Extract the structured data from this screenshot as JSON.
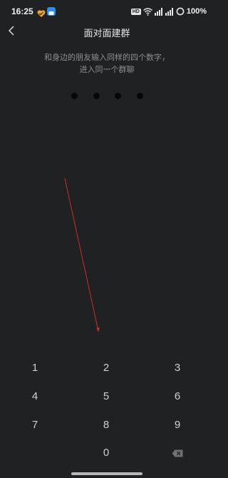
{
  "status_bar": {
    "time": "16:25",
    "hd_label": "HD",
    "battery": "100%"
  },
  "header": {
    "title": "面对面建群",
    "back_icon": "chevron-left-icon"
  },
  "instruction": {
    "line1": "和身边的朋友输入同样的四个数字，",
    "line2": "进入同一个群聊"
  },
  "code": {
    "digits_entered": 0,
    "length": 4
  },
  "keypad": {
    "keys": [
      "1",
      "2",
      "3",
      "4",
      "5",
      "6",
      "7",
      "8",
      "9",
      "0"
    ],
    "delete_icon": "backspace-icon"
  },
  "colors": {
    "background": "#1f2123",
    "annotation": "#d42a2a"
  }
}
